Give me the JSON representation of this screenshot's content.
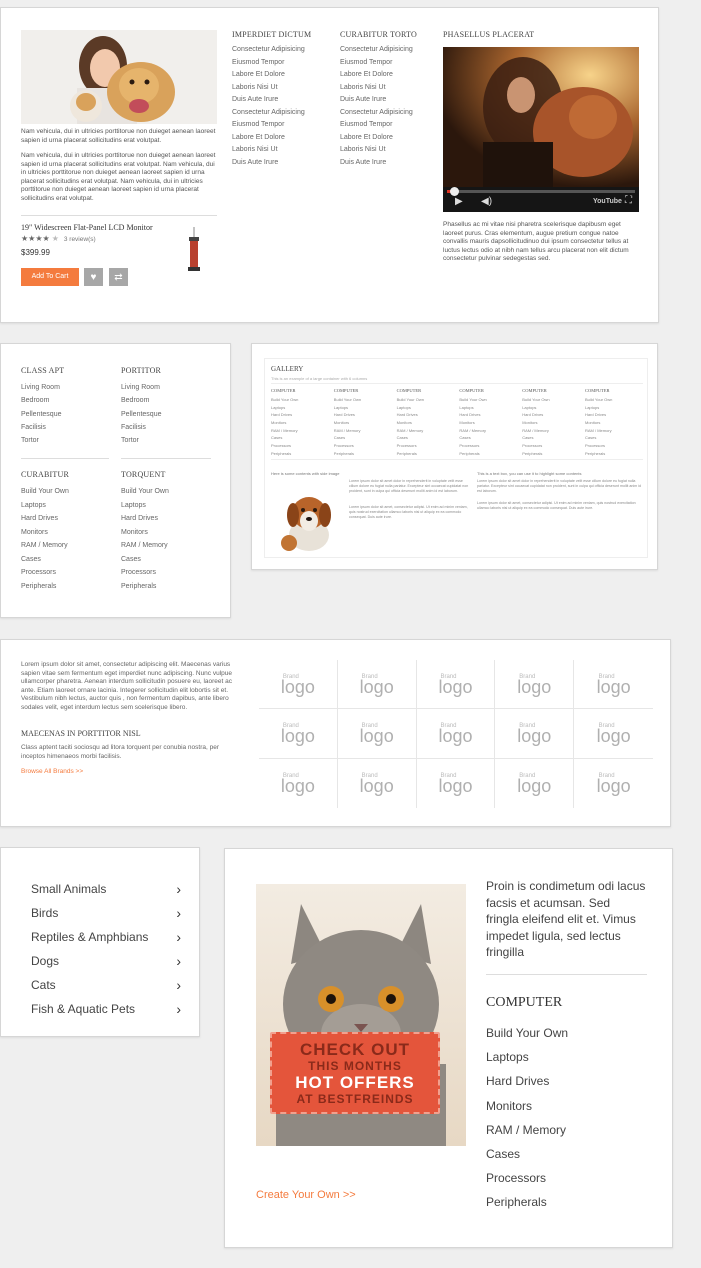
{
  "panel1": {
    "intro_text_1": "Nam vehicula, dui in ultricies porttitorue non duieget aenean laoreet sapien id urna placerat sollicitudins erat volutpat.",
    "intro_text_2": "Nam vehicula, dui in ultricies porttitorue non duieget aenean laoreet sapien id urna placerat sollicitudins erat volutpat. Nam vehicula, dui in ultricies porttitorue non duieget aenean laoreet sapien id urna placerat sollicitudins erat volutpat. Nam vehicula, dui in ultricies porttitorue non duieget aenean laoreet sapien id urna placerat sollicitudins erat volutpat.",
    "product": {
      "name": "19\" Widescreen Flat-Panel LCD Monitor",
      "stars": "★★★★",
      "star_empty": "★",
      "reviews": "3 review(s)",
      "price": "$399.99",
      "add_to_cart": "Add To Cart"
    },
    "col1": {
      "title": "IMPERDIET DICTUM",
      "items": [
        "Consectetur Adipisicing",
        "Eiusmod Tempor",
        "Labore Et Dolore",
        "Laboris Nisi Ut",
        "Duis Aute Irure",
        "Consectetur Adipisicing",
        "Eiusmod Tempor",
        "Labore Et Dolore",
        "Laboris Nisi Ut",
        "Duis Aute Irure"
      ]
    },
    "col2": {
      "title": "CURABITUR TORTO",
      "items": [
        "Consectetur Adipisicing",
        "Eiusmod Tempor",
        "Labore Et Dolore",
        "Laboris Nisi Ut",
        "Duis Aute Irure",
        "Consectetur Adipisicing",
        "Eiusmod Tempor",
        "Labore Et Dolore",
        "Laboris Nisi Ut",
        "Duis Aute Irure"
      ]
    },
    "video": {
      "title": "PHASELLUS PLACERAT",
      "caption": "Phasellus ac mi vitae nisi pharetra scelerisque dapibusm eget laoreet purus. Cras elementum, augue pretium congue natoe convallis mauris dapsollicitudinuo dui ipsum consectetur tellus at luctus lectus odio at nibh nam tellus arcu placerat non elit dictum consectetur pulvinar sedegestas sed.",
      "youtube": "YouTube",
      "progress": 0.05
    }
  },
  "panel2": {
    "groups": [
      {
        "title": "CLASS APT",
        "items": [
          "Living Room",
          "Bedroom",
          "Pellentesque",
          "Facilisis",
          "Tortor"
        ]
      },
      {
        "title": "PORTITOR",
        "items": [
          "Living Room",
          "Bedroom",
          "Pellentesque",
          "Facilisis",
          "Tortor"
        ]
      },
      {
        "title": "CURABITUR",
        "items": [
          "Build Your Own",
          "Laptops",
          "Hard Drives",
          "Monitors",
          "RAM / Memory",
          "Cases",
          "Processors",
          "Peripherals"
        ]
      },
      {
        "title": "TORQUENT",
        "items": [
          "Build Your Own",
          "Laptops",
          "Hard Drives",
          "Monitors",
          "RAM / Memory",
          "Cases",
          "Processors",
          "Peripherals"
        ]
      }
    ]
  },
  "panel3": {
    "title": "GALLERY",
    "subtitle": "This is an example of a large container with 6 columns",
    "col_title": "COMPUTER",
    "items": [
      "Build Your Own",
      "Laptops",
      "Hard Drives",
      "Monitors",
      "RAM / Memory",
      "Cases",
      "Processors",
      "Peripherals"
    ],
    "left_caption": "Here is some contents with side image",
    "right_caption": "This is a text box, you can use it to highlight some contents",
    "para": "Lorem ipsum dolor sit amet dolor in reprehenderit in voluptate velit esse cillum dolore eu fugiat nulla pariatur. Excepteur sint occaecat cupidatat non proident, sunt in culpa qui officia deserunt mollit anim id est laborum.",
    "para2": "Lorem ipsum dolor sit amet, consectetur adipisi. Ut enim ad minim veniam, quis nostrud exercitation ullamco laboris nisi ut aliquip ex ea commodo consequat. Duis aute irure."
  },
  "panel4": {
    "text": "Lorem ipsum dolor sit amet, consectetur adipiscing elit. Maecenas varius sapien vitae sem fermentum eget imperdiet nunc adipiscing. Nunc vulpue ullamcorper pharetra. Aenean interdum sollicitudin posuere eu, laoreet ac ante. Etiam laoreet ornare lacinia. Integerer sollicitudin elit lobortis sit et. Vestibulum nibh lectus, auctor quis , non fermentum dapibus, ante libero sodales velit, eget interdum lectus sem scelerisque libero.",
    "subtitle": "MAECENAS IN PORTTITOR NISL",
    "sub_text": "Class aptent taciti sociosqu ad litora torquent per conubia nostra, per inceptos himenaeos morbi facilisis.",
    "link": "Browse All Brands >>",
    "brand_small": "Brand",
    "brand_big": "logo"
  },
  "panel5": {
    "items": [
      "Small Animals",
      "Birds",
      "Reptiles & Amphbians",
      "Dogs",
      "Cats",
      "Fish & Aquatic Pets"
    ]
  },
  "panel6": {
    "promo": {
      "line1": "CHECK OUT",
      "line2": "THIS MONTHS",
      "line3": "HOT OFFERS",
      "line4": "AT BESTFREINDS"
    },
    "link": "Create Your Own >>",
    "text": "Proin is condimetum odi lacus facsis et acumsan. Sed fringla eleifend elit et. Vimus impedet ligula, sed lectus fringilla",
    "title": "COMPUTER",
    "items": [
      "Build Your Own",
      "Laptops",
      "Hard Drives",
      "Monitors",
      "RAM / Memory",
      "Cases",
      "Processors",
      "Peripherals"
    ]
  },
  "colors": {
    "accent": "#f47b3e",
    "promo": "#e4553b"
  }
}
